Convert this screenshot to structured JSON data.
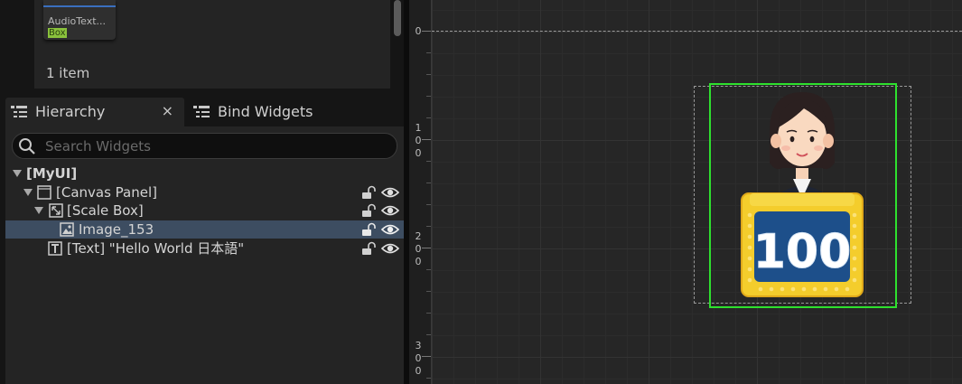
{
  "palette": {
    "card_name": "AudioText...",
    "card_tag": "Box",
    "item_count": "1 item"
  },
  "tabs": {
    "hierarchy": "Hierarchy",
    "bind_widgets": "Bind Widgets",
    "close_symbol": "×"
  },
  "search": {
    "placeholder": "Search Widgets",
    "value": ""
  },
  "tree": {
    "root": "[MyUI]",
    "canvas_panel": "[Canvas Panel]",
    "scale_box": "[Scale Box]",
    "image": "Image_153",
    "text": "[Text] \"Hello World 日本語\""
  },
  "ruler": {
    "label_0": "0",
    "label_100": [
      "1",
      "0",
      "0"
    ],
    "label_200": [
      "2",
      "0",
      "0"
    ],
    "label_300": [
      "3",
      "0",
      "0"
    ]
  },
  "preview": {
    "score": "100"
  },
  "icons": {
    "tab_hierarchy": "tree-list-icon",
    "tab_bind": "tree-list-icon",
    "search": "search-icon",
    "lock": "lock-open-icon",
    "visibility": "eye-icon",
    "canvas_panel": "canvas-panel-icon",
    "scale_box": "scale-box-icon",
    "image": "image-icon",
    "text": "text-icon"
  },
  "colors": {
    "selection": "#3d4d61",
    "image_outline": "#2ee02e",
    "accent_tag": "#8ac23c"
  }
}
